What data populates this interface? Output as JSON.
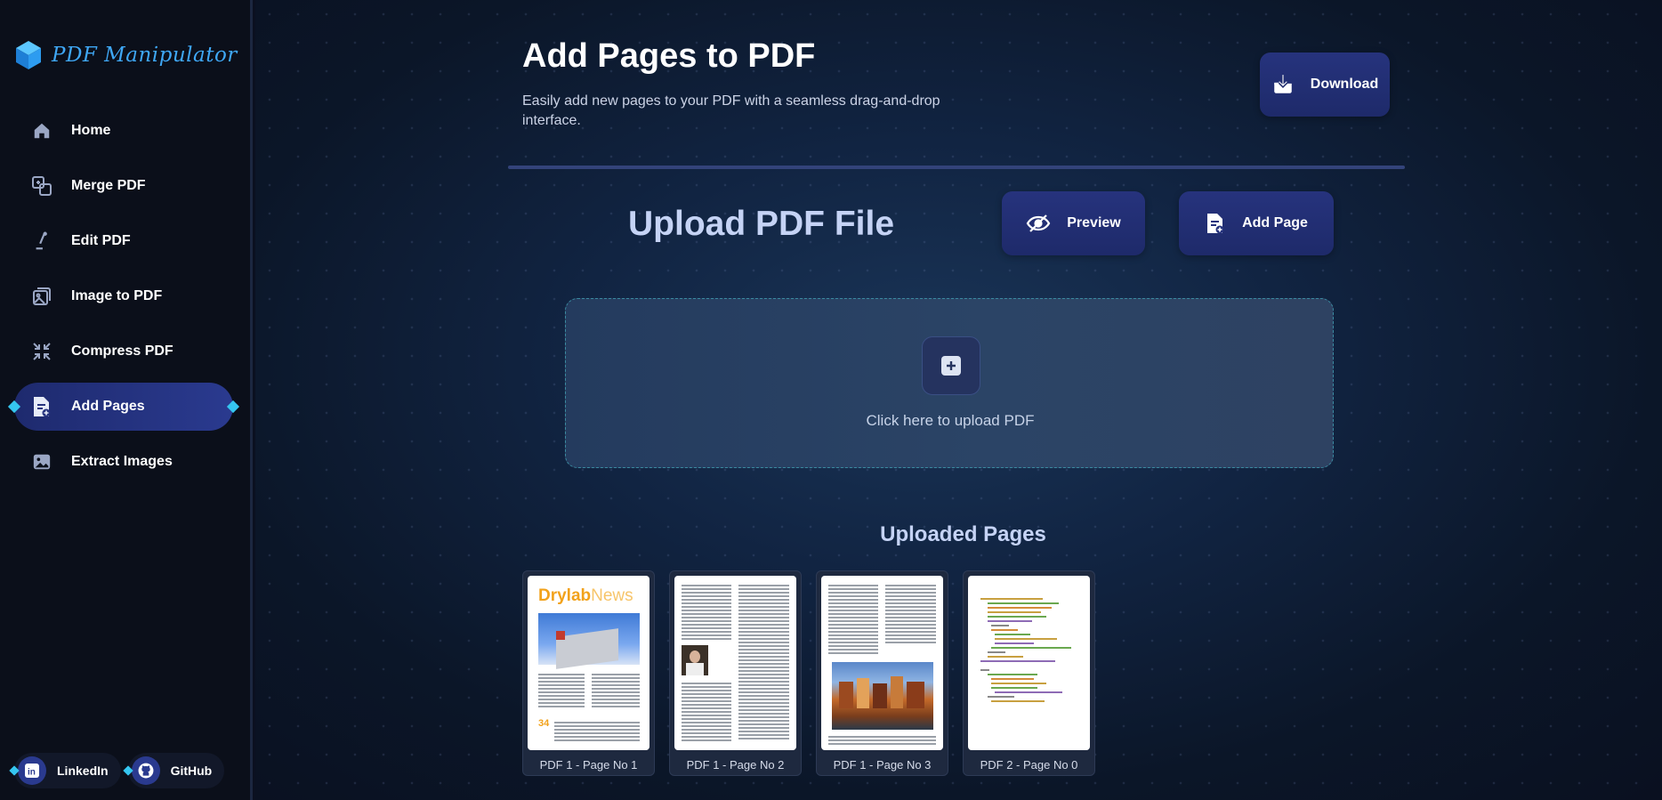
{
  "app": {
    "name": "PDF Manipulator"
  },
  "sidebar": {
    "items": [
      {
        "label": "Home",
        "icon": "home-icon"
      },
      {
        "label": "Merge PDF",
        "icon": "merge-icon"
      },
      {
        "label": "Edit PDF",
        "icon": "pen-icon"
      },
      {
        "label": "Image to PDF",
        "icon": "image-stack-icon"
      },
      {
        "label": "Compress PDF",
        "icon": "compress-icon"
      },
      {
        "label": "Add Pages",
        "icon": "add-document-icon",
        "active": true
      },
      {
        "label": "Extract Images",
        "icon": "image-icon"
      }
    ],
    "social": [
      {
        "label": "LinkedIn",
        "icon": "linkedin-icon"
      },
      {
        "label": "GitHub",
        "icon": "github-icon"
      }
    ]
  },
  "header": {
    "title": "Add Pages to PDF",
    "subtitle": "Easily add new pages to your PDF with a seamless drag-and-drop interface.",
    "download_label": "Download"
  },
  "upload": {
    "title": "Upload PDF File",
    "preview_label": "Preview",
    "add_page_label": "Add Page",
    "dropzone_text": "Click here to upload PDF"
  },
  "uploaded": {
    "title": "Uploaded Pages",
    "pages": [
      {
        "label": "PDF 1 - Page No 1",
        "masthead": "Drylab",
        "masthead_suffix": "News",
        "number": "34"
      },
      {
        "label": "PDF 1 - Page No 2"
      },
      {
        "label": "PDF 1 - Page No 3"
      },
      {
        "label": "PDF 2 - Page No 0"
      }
    ]
  },
  "colors": {
    "accent": "#35c6f0",
    "brand": "#3fa7f5",
    "button": "#26337d",
    "sidebar_bg": "#0b0f1a"
  }
}
